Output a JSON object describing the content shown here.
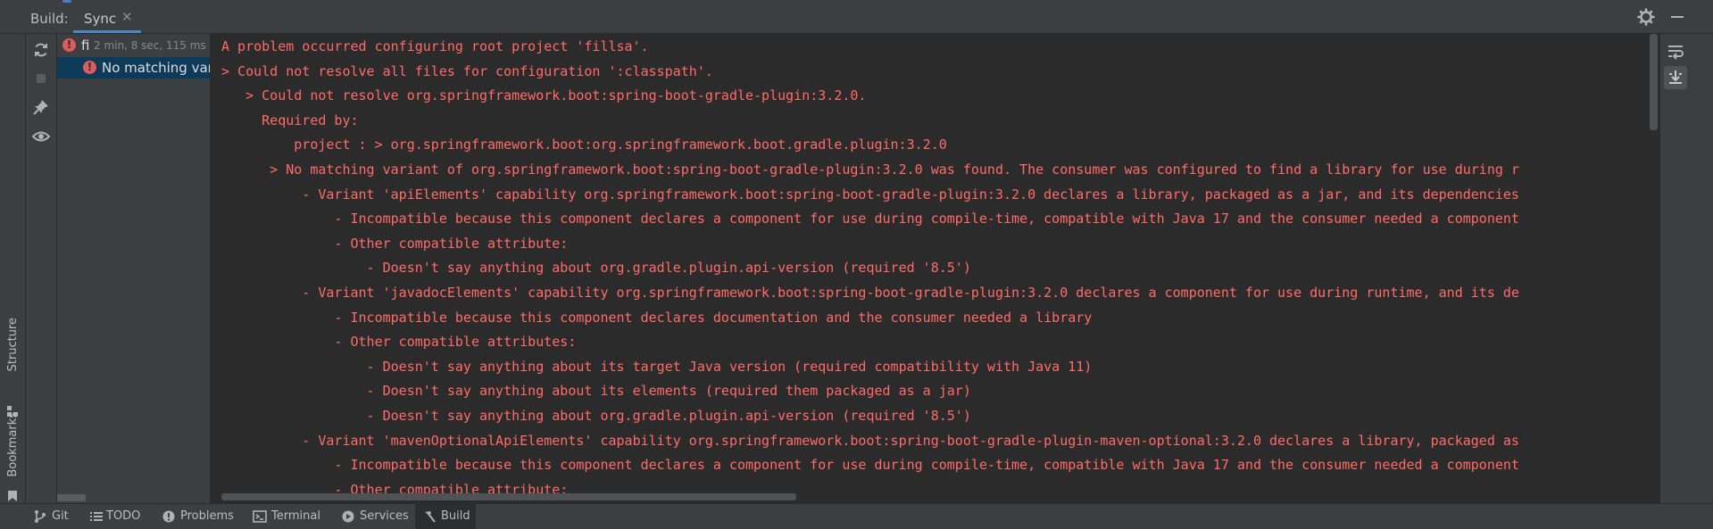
{
  "header": {
    "title": "Build:",
    "tab_label": "Sync",
    "tab_close": "✕",
    "gear_icon": "gear-icon",
    "minimize_icon": "minimize-icon"
  },
  "left_strip": {
    "structure_label": "Structure",
    "bookmarks_label": "Bookmarks"
  },
  "actions": [
    "sync-icon",
    "stop-icon",
    "pin-icon",
    "eye-icon"
  ],
  "tree": {
    "items": [
      {
        "name": "fi",
        "meta": "2 min, 8 sec, 115 ms",
        "status": "error"
      },
      {
        "name": "No matching vari",
        "status": "error",
        "selected": true
      }
    ]
  },
  "console": {
    "lines": [
      "A problem occurred configuring root project 'fillsa'.",
      "> Could not resolve all files for configuration ':classpath'.",
      "   > Could not resolve org.springframework.boot:spring-boot-gradle-plugin:3.2.0.",
      "     Required by:",
      "         project : > org.springframework.boot:org.springframework.boot.gradle.plugin:3.2.0",
      "      > No matching variant of org.springframework.boot:spring-boot-gradle-plugin:3.2.0 was found. The consumer was configured to find a library for use during r",
      "          - Variant 'apiElements' capability org.springframework.boot:spring-boot-gradle-plugin:3.2.0 declares a library, packaged as a jar, and its dependencies",
      "              - Incompatible because this component declares a component for use during compile-time, compatible with Java 17 and the consumer needed a component",
      "              - Other compatible attribute:",
      "                  - Doesn't say anything about org.gradle.plugin.api-version (required '8.5')",
      "          - Variant 'javadocElements' capability org.springframework.boot:spring-boot-gradle-plugin:3.2.0 declares a component for use during runtime, and its de",
      "              - Incompatible because this component declares documentation and the consumer needed a library",
      "              - Other compatible attributes:",
      "                  - Doesn't say anything about its target Java version (required compatibility with Java 11)",
      "                  - Doesn't say anything about its elements (required them packaged as a jar)",
      "                  - Doesn't say anything about org.gradle.plugin.api-version (required '8.5')",
      "          - Variant 'mavenOptionalApiElements' capability org.springframework.boot:spring-boot-gradle-plugin-maven-optional:3.2.0 declares a library, packaged as",
      "              - Incompatible because this component declares a component for use during compile-time, compatible with Java 17 and the consumer needed a component",
      "              - Other compatible attribute:"
    ]
  },
  "right_strip": [
    "soft-wrap-icon",
    "scroll-to-end-icon"
  ],
  "bottom_bar": {
    "tabs": [
      {
        "label": "Git",
        "icon": "git-branch-icon"
      },
      {
        "label": "TODO",
        "icon": "list-icon"
      },
      {
        "label": "Problems",
        "icon": "problems-icon"
      },
      {
        "label": "Terminal",
        "icon": "terminal-icon"
      },
      {
        "label": "Services",
        "icon": "services-icon"
      },
      {
        "label": "Build",
        "icon": "build-hammer-icon",
        "active": true
      }
    ]
  },
  "colors": {
    "error_text": "#ff6b68",
    "accent": "#4a88c7",
    "selection": "#0d3a58",
    "console_bg": "#2b2b2b",
    "panel_bg": "#3c3f41"
  }
}
